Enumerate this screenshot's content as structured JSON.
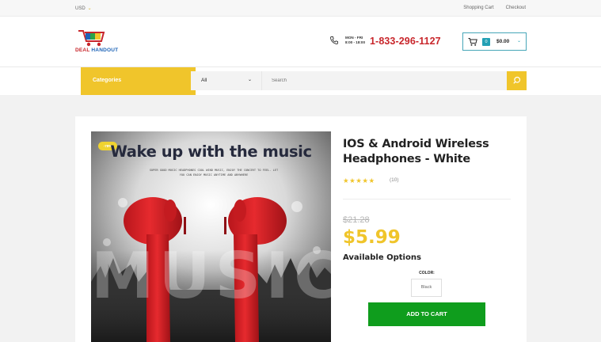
{
  "topbar": {
    "currency": "USD",
    "links": [
      "Shopping Cart",
      "Checkout"
    ]
  },
  "header": {
    "logo_text_red": "DEAL",
    "logo_text_blue": "HANDOUT",
    "hours_line1": "MON - FRI",
    "hours_line2": "8:00 - 18:00",
    "phone": "1-833-296-1127",
    "cart_count": "0",
    "cart_total": "$0.00"
  },
  "nav": {
    "categories_label": "Categories",
    "search_category": "All",
    "search_placeholder": "Search"
  },
  "product": {
    "image": {
      "badge": "-78%",
      "headline": "Wake up with the music",
      "subtext": "SUPER GOOD MUSIC HEADPHONES COOL WIND MUSIC, ENJOY THE CONCERT TO FEEL. LET YOU CAN ENJOY MUSIC ANYTIME AND ANYWHERE",
      "watermark": "MUSIC"
    },
    "title": "IOS & Android Wireless Headphones - White",
    "stars": "★★★★★",
    "rating": 5,
    "reviews": "(10)",
    "old_price": "$21.28",
    "price": "$5.99",
    "options_title": "Available Options",
    "color_label": "COLOR:",
    "color_value": "Black",
    "add_to_cart": "ADD TO CART"
  },
  "colors": {
    "accent_yellow": "#f0c52b",
    "phone_red": "#c8262b",
    "cart_teal": "#23a0b5",
    "button_green": "#0f9d1d"
  }
}
